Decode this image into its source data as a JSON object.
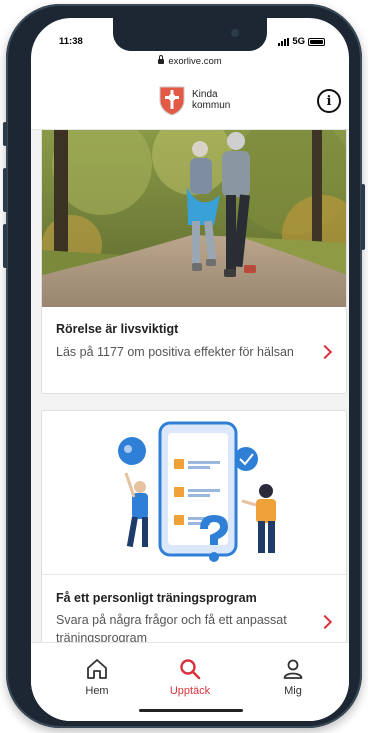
{
  "status_bar": {
    "time": "11:38",
    "network": "5G"
  },
  "browser": {
    "url": "exorlive.com"
  },
  "header": {
    "logo_line1": "Kinda",
    "logo_line2": "kommun",
    "info_symbol": "i"
  },
  "cards": [
    {
      "title": "Rörelse är livsviktigt",
      "description": "Läs på 1177 om positiva effekter för hälsan"
    },
    {
      "title": "Få ett personligt träningsprogram",
      "description": "Svara på några frågor och få ett anpassat träningsprogram"
    }
  ],
  "tabbar": {
    "items": [
      {
        "label": "Hem",
        "icon": "home-icon"
      },
      {
        "label": "Upptäck",
        "icon": "search-icon",
        "active": true
      },
      {
        "label": "Mig",
        "icon": "person-icon"
      }
    ]
  },
  "colors": {
    "accent": "#d8323c",
    "frame": "#1c2733",
    "background": "#f3f3f3",
    "illustration_blue": "#2f7fd6",
    "illustration_orange": "#f0a23a"
  }
}
